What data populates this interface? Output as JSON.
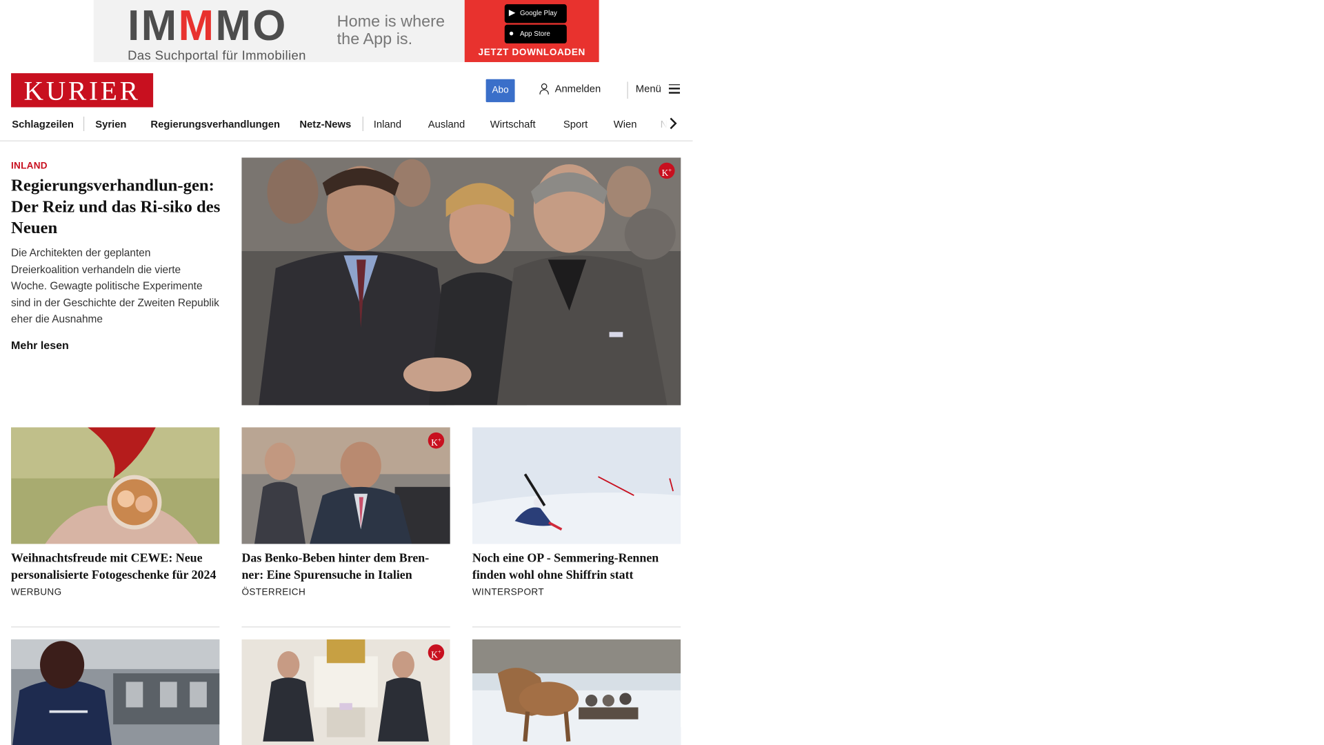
{
  "ad": {
    "logo_part1": "IM",
    "logo_m": "M",
    "logo_part2": "MO",
    "subtitle": "Das Suchportal für Immobilien",
    "slogan_line1": "Home is where",
    "slogan_line2": "the App is.",
    "google_play": "Google Play",
    "app_store": "App Store",
    "cta": "JETZT DOWNLOADEN",
    "colors": {
      "brand_red": "#e8322e",
      "background": "#f2f2f2"
    }
  },
  "header": {
    "logo": "KURIER",
    "abo": "Abo",
    "login": "Anmelden",
    "menu": "Menü",
    "colors": {
      "logo_bg": "#c8101f",
      "abo_bg": "#3a6fc9"
    }
  },
  "nav": {
    "items": [
      {
        "label": "Schlagzeilen"
      },
      {
        "label": "Syrien"
      },
      {
        "label": "Regierungsverhandlungen"
      },
      {
        "label": "Netz-News"
      },
      {
        "label": "Inland"
      },
      {
        "label": "Ausland"
      },
      {
        "label": "Wirtschaft"
      },
      {
        "label": "Sport"
      },
      {
        "label": "Wien"
      },
      {
        "label": "NÖ"
      }
    ]
  },
  "lead": {
    "category": "INLAND",
    "title": "Regierungsverhandlun-gen: Der Reiz und das Ri-siko des Neuen",
    "text": "Die Architekten der geplanten Dreierkoalition verhandeln die vierte Woche. Gewagte politische Experimente sind in der Geschichte der Zweiten Republik eher die Ausnahme",
    "more": "Mehr lesen",
    "premium_badge": "K+"
  },
  "teasers": [
    {
      "title": "Weihnachtsfreude mit CEWE: Neue personalisierte Fotogeschenke für 2024",
      "category": "WERBUNG",
      "premium": false
    },
    {
      "title": "Das Benko-Beben hinter dem Bren-ner: Eine Spurensuche in Italien",
      "category": "ÖSTERREICH",
      "premium": true
    },
    {
      "title": "Noch eine OP - Semmering-Rennen finden wohl ohne Shiffrin statt",
      "category": "WINTERSPORT",
      "premium": false
    }
  ],
  "premium_badge": "K+"
}
